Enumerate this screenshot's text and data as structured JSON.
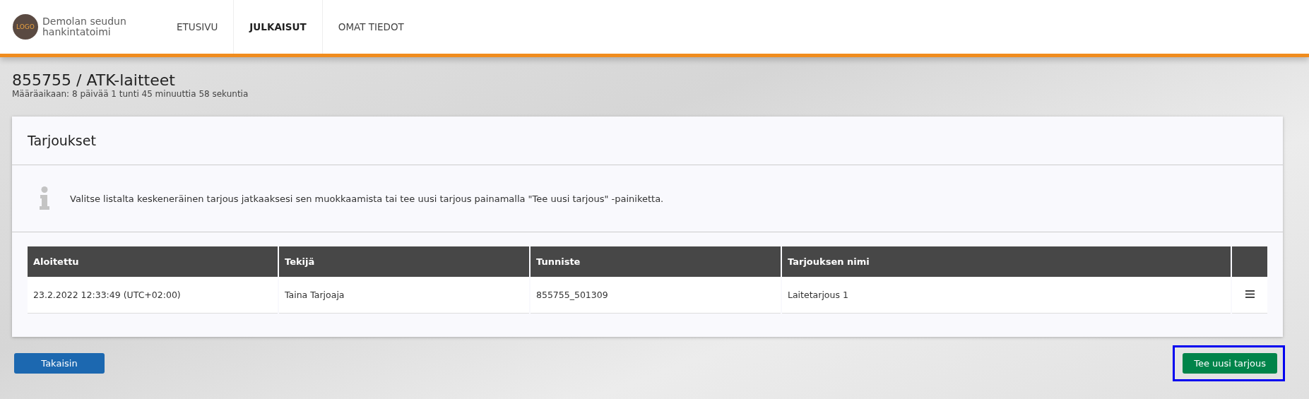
{
  "header": {
    "logo_text": "LOGO",
    "org_name_lines": [
      "Demolan seudun",
      "hankintatoimi"
    ],
    "nav": [
      {
        "label": "ETUSIVU",
        "selected": false
      },
      {
        "label": "JULKAISUT",
        "selected": true
      },
      {
        "label": "OMAT TIEDOT",
        "selected": false
      }
    ]
  },
  "page": {
    "title": "855755 / ATK-laitteet",
    "deadline": "Määräaikaan: 8 päivää 1 tunti 45 minuuttia 58 sekuntia"
  },
  "card": {
    "title": "Tarjoukset",
    "info": "Valitse listalta keskeneräinen tarjous jatkaaksesi sen muokkaamista tai tee uusi tarjous painamalla \"Tee uusi tarjous\" -painiketta.",
    "table": {
      "columns": [
        "Aloitettu",
        "Tekijä",
        "Tunniste",
        "Tarjouksen nimi"
      ],
      "rows": [
        {
          "cells": [
            "23.2.2022 12:33:49 (UTC+02:00)",
            "Taina Tarjoaja",
            "855755_501309",
            "Laitetarjous 1"
          ]
        }
      ]
    }
  },
  "buttons": [
    {
      "label": "Takaisin",
      "kind": "secondary",
      "highlighted": false
    },
    {
      "label": "Tee uusi tarjous",
      "kind": "primary",
      "highlighted": true
    }
  ]
}
